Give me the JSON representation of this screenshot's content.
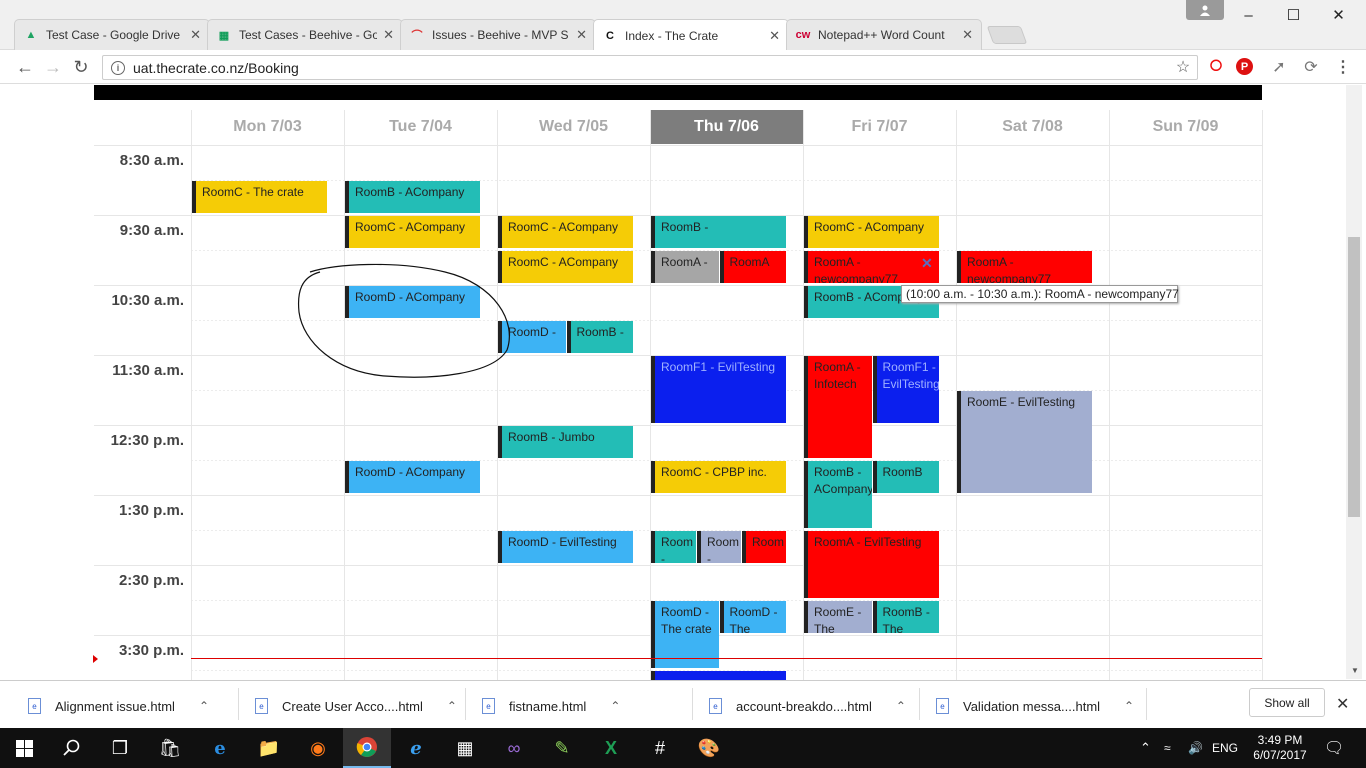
{
  "browser": {
    "tabs": [
      {
        "title": "Test Case - Google Drive",
        "icon": "google-drive-icon",
        "active": false
      },
      {
        "title": "Test Cases - Beehive - Go",
        "icon": "google-sheets-icon",
        "active": false
      },
      {
        "title": "Issues - Beehive - MVP S",
        "icon": "jira-icon",
        "active": false
      },
      {
        "title": "Index - The Crate",
        "icon": "crate-c-icon",
        "active": true
      },
      {
        "title": "Notepad++ Word Count",
        "icon": "cw-icon",
        "active": false
      }
    ],
    "url": "uat.thecrate.co.nz/Booking"
  },
  "calendar": {
    "days": [
      "Mon 7/03",
      "Tue 7/04",
      "Wed 7/05",
      "Thu 7/06",
      "Fri 7/07",
      "Sat 7/08",
      "Sun 7/09"
    ],
    "today_index": 3,
    "times": [
      "8:30 a.m.",
      "9:30 a.m.",
      "10:30 a.m.",
      "11:30 a.m.",
      "12:30 p.m.",
      "1:30 p.m.",
      "2:30 p.m.",
      "3:30 p.m."
    ],
    "events": [
      {
        "day": 0,
        "slot": 1,
        "slots": 1,
        "col": 0,
        "cols": 1,
        "color": "yellow",
        "text": "RoomC - The crate"
      },
      {
        "day": 1,
        "slot": 1,
        "slots": 1,
        "col": 0,
        "cols": 1,
        "color": "teal",
        "text": "RoomB - ACompany"
      },
      {
        "day": 1,
        "slot": 2,
        "slots": 1,
        "col": 0,
        "cols": 1,
        "color": "yellow",
        "text": "RoomC - ACompany"
      },
      {
        "day": 1,
        "slot": 4,
        "slots": 1,
        "col": 0,
        "cols": 1,
        "color": "blue2",
        "text": "RoomD - ACompany"
      },
      {
        "day": 1,
        "slot": 9,
        "slots": 1,
        "col": 0,
        "cols": 1,
        "color": "blue2",
        "text": "RoomD - ACompany"
      },
      {
        "day": 2,
        "slot": 2,
        "slots": 1,
        "col": 0,
        "cols": 1,
        "color": "yellow",
        "text": "RoomC - ACompany"
      },
      {
        "day": 2,
        "slot": 3,
        "slots": 1,
        "col": 0,
        "cols": 1,
        "color": "yellow",
        "text": "RoomC - ACompany"
      },
      {
        "day": 2,
        "slot": 5,
        "slots": 1,
        "col": 0,
        "cols": 2,
        "color": "blue2",
        "text": "RoomD -"
      },
      {
        "day": 2,
        "slot": 5,
        "slots": 1,
        "col": 1,
        "cols": 2,
        "color": "teal",
        "text": "RoomB -"
      },
      {
        "day": 2,
        "slot": 8,
        "slots": 1,
        "col": 0,
        "cols": 1,
        "color": "teal",
        "text": "RoomB - Jumbo"
      },
      {
        "day": 2,
        "slot": 11,
        "slots": 1,
        "col": 0,
        "cols": 1,
        "color": "blue2",
        "text": "RoomD - EvilTesting"
      },
      {
        "day": 3,
        "slot": 2,
        "slots": 1,
        "col": 0,
        "cols": 1,
        "color": "teal",
        "text": "RoomB -"
      },
      {
        "day": 3,
        "slot": 3,
        "slots": 1,
        "col": 0,
        "cols": 2,
        "color": "grey",
        "text": "RoomA -"
      },
      {
        "day": 3,
        "slot": 3,
        "slots": 1,
        "col": 1,
        "cols": 2,
        "color": "red",
        "text": "RoomA"
      },
      {
        "day": 3,
        "slot": 6,
        "slots": 2,
        "col": 0,
        "cols": 1,
        "color": "navy",
        "text": "RoomF1 - EvilTesting"
      },
      {
        "day": 3,
        "slot": 9,
        "slots": 1,
        "col": 0,
        "cols": 1,
        "color": "yellow",
        "text": "RoomC - CPBP inc."
      },
      {
        "day": 3,
        "slot": 11,
        "slots": 1,
        "col": 0,
        "cols": 3,
        "color": "teal",
        "text": "Room -"
      },
      {
        "day": 3,
        "slot": 11,
        "slots": 1,
        "col": 1,
        "cols": 3,
        "color": "lav",
        "text": "Room -"
      },
      {
        "day": 3,
        "slot": 11,
        "slots": 1,
        "col": 2,
        "cols": 3,
        "color": "red",
        "text": "Room"
      },
      {
        "day": 3,
        "slot": 13,
        "slots": 2,
        "col": 0,
        "cols": 2,
        "color": "blue2",
        "text": "RoomD - The crate"
      },
      {
        "day": 3,
        "slot": 13,
        "slots": 1,
        "col": 1,
        "cols": 2,
        "color": "blue2",
        "text": "RoomD - The"
      },
      {
        "day": 3,
        "slot": 15,
        "slots": 1,
        "col": 0,
        "cols": 1,
        "color": "navy",
        "text": ""
      },
      {
        "day": 4,
        "slot": 2,
        "slots": 1,
        "col": 0,
        "cols": 1,
        "color": "yellow",
        "text": "RoomC - ACompany"
      },
      {
        "day": 4,
        "slot": 3,
        "slots": 1,
        "col": 0,
        "cols": 1,
        "color": "red",
        "text": "RoomA - newcompany77"
      },
      {
        "day": 4,
        "slot": 4,
        "slots": 1,
        "col": 0,
        "cols": 1,
        "color": "teal",
        "text": "RoomB - ACompany"
      },
      {
        "day": 4,
        "slot": 6,
        "slots": 3,
        "col": 0,
        "cols": 2,
        "color": "red",
        "text": "RoomA - Infotech"
      },
      {
        "day": 4,
        "slot": 6,
        "slots": 2,
        "col": 1,
        "cols": 2,
        "color": "navy",
        "text": "RoomF1 - EvilTesting"
      },
      {
        "day": 4,
        "slot": 9,
        "slots": 2,
        "col": 0,
        "cols": 2,
        "color": "teal",
        "text": "RoomB - ACompany"
      },
      {
        "day": 4,
        "slot": 9,
        "slots": 1,
        "col": 1,
        "cols": 2,
        "color": "teal",
        "text": "RoomB"
      },
      {
        "day": 4,
        "slot": 11,
        "slots": 2,
        "col": 0,
        "cols": 1,
        "color": "red",
        "text": "RoomA - EvilTesting"
      },
      {
        "day": 4,
        "slot": 13,
        "slots": 1,
        "col": 0,
        "cols": 2,
        "color": "lav",
        "text": "RoomE - The"
      },
      {
        "day": 4,
        "slot": 13,
        "slots": 1,
        "col": 1,
        "cols": 2,
        "color": "teal",
        "text": "RoomB - The"
      },
      {
        "day": 5,
        "slot": 3,
        "slots": 1,
        "col": 0,
        "cols": 1,
        "color": "red",
        "text": "RoomA - newcompany77"
      },
      {
        "day": 5,
        "slot": 7,
        "slots": 3,
        "col": 0,
        "cols": 1,
        "color": "lav",
        "text": "RoomE - EvilTesting"
      }
    ],
    "tooltip": "(10:00 a.m. - 10:30 a.m.): RoomA - newcompany77"
  },
  "downloads": {
    "items": [
      "Alignment issue.html",
      "Create User Acco....html",
      "fistname.html",
      "account-breakdo....html",
      "Validation messa....html"
    ],
    "show_all": "Show all"
  },
  "taskbar": {
    "lang": "ENG",
    "time": "3:49 PM",
    "date": "6/07/2017"
  }
}
